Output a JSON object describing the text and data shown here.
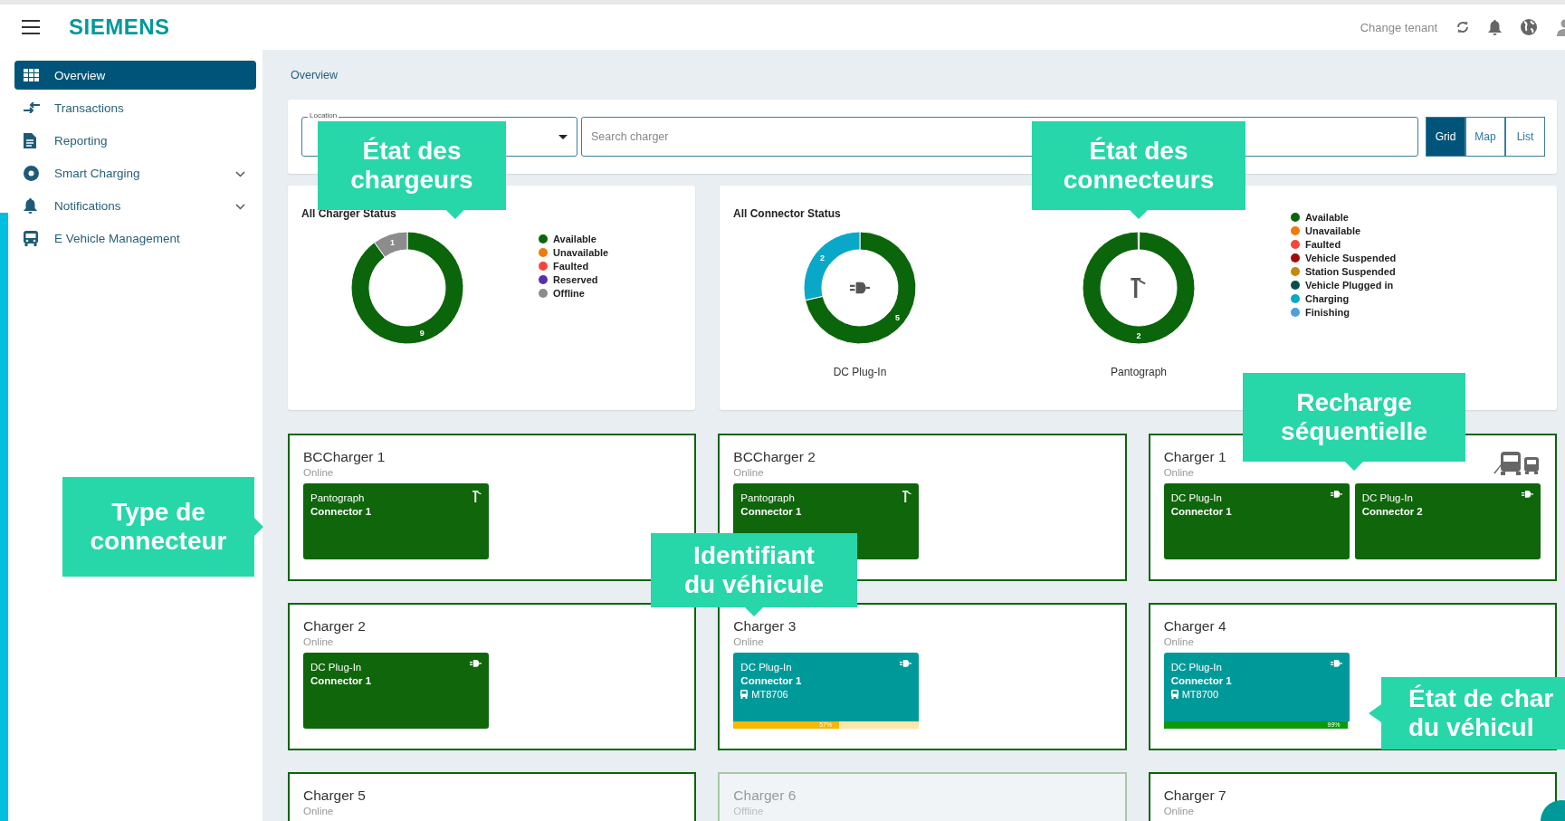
{
  "header": {
    "logo": "SIEMENS",
    "tenant_label": "Change tenant"
  },
  "sidebar": {
    "items": [
      {
        "label": "Overview",
        "selected": true,
        "expandable": false
      },
      {
        "label": "Transactions",
        "selected": false,
        "expandable": false
      },
      {
        "label": "Reporting",
        "selected": false,
        "expandable": false
      },
      {
        "label": "Smart Charging",
        "selected": false,
        "expandable": true
      },
      {
        "label": "Notifications",
        "selected": false,
        "expandable": true
      },
      {
        "label": "E Vehicle Management",
        "selected": false,
        "expandable": false
      }
    ]
  },
  "breadcrumb": "Overview",
  "filters": {
    "location": {
      "label": "Location"
    },
    "search": {
      "placeholder": "Search charger"
    },
    "views": [
      {
        "label": "Grid",
        "selected": true
      },
      {
        "label": "Map",
        "selected": false
      },
      {
        "label": "List",
        "selected": false
      }
    ]
  },
  "charger_status": {
    "title": "All Charger Status",
    "chart_data": {
      "type": "donut",
      "categories": [
        "Available",
        "Unavailable",
        "Faulted",
        "Reserved",
        "Offline"
      ],
      "values": [
        9,
        0,
        0,
        0,
        1
      ],
      "colors": [
        "#0b650b",
        "#f07a0a",
        "#f4473a",
        "#5530b0",
        "#8c8c8c"
      ],
      "legend": "right",
      "data_labels": true
    }
  },
  "connector_status": {
    "title": "All Connector Status",
    "charts": [
      {
        "kind": "plug"
      },
      {
        "kind": "pantograph"
      }
    ],
    "chart_data": {
      "type": "donut",
      "categories": [
        "Available",
        "Unavailable",
        "Faulted",
        "Vehicle Suspended",
        "Station Suspended",
        "Vehicle Plugged in",
        "Charging",
        "Finishing"
      ],
      "legend": "right",
      "data_labels": true,
      "series": [
        {
          "name": "DC Plug-In",
          "values": [
            5,
            0,
            0,
            0,
            0,
            0,
            2,
            0
          ],
          "colors": [
            "#0b650b",
            "#f07a0a",
            "#f4473a",
            "#a30a0a",
            "#c8860f",
            "#0c4f4a",
            "#0aa8c8",
            "#4aa0e0"
          ]
        },
        {
          "name": "Pantograph",
          "values": [
            2,
            0,
            0,
            0,
            0,
            0,
            0,
            0
          ],
          "color": "#0b650b"
        }
      ]
    }
  },
  "chargers": [
    {
      "name": "BCCharger 1",
      "status": "Online",
      "online": true,
      "sequential": false,
      "connectors": [
        {
          "type": "Pantograph",
          "kind": "pantograph",
          "name": "Connector 1",
          "charging": false
        }
      ]
    },
    {
      "name": "BCCharger 2",
      "status": "Online",
      "online": true,
      "sequential": false,
      "connectors": [
        {
          "type": "Pantograph",
          "kind": "pantograph",
          "name": "Connector 1",
          "charging": false
        }
      ]
    },
    {
      "name": "Charger 1",
      "status": "Online",
      "online": true,
      "sequential": true,
      "connectors": [
        {
          "type": "DC Plug-In",
          "kind": "plug",
          "name": "Connector 1",
          "charging": false
        },
        {
          "type": "DC Plug-In",
          "kind": "plug",
          "name": "Connector 2",
          "charging": false
        }
      ]
    },
    {
      "name": "Charger 2",
      "status": "Online",
      "online": true,
      "sequential": false,
      "connectors": [
        {
          "type": "DC Plug-In",
          "kind": "plug",
          "name": "Connector 1",
          "charging": false
        }
      ]
    },
    {
      "name": "Charger 3",
      "status": "Online",
      "online": true,
      "sequential": false,
      "connectors": [
        {
          "type": "DC Plug-In",
          "kind": "plug",
          "name": "Connector 1",
          "charging": true,
          "vehicle": "MT8706",
          "level": 0.57,
          "reading": "57%"
        }
      ]
    },
    {
      "name": "Charger 4",
      "status": "Online",
      "online": true,
      "sequential": false,
      "connectors": [
        {
          "type": "DC Plug-In",
          "kind": "plug",
          "name": "Connector 1",
          "charging": true,
          "vehicle": "MT8700",
          "level": 0.99,
          "reading": "99%"
        }
      ]
    },
    {
      "name": "Charger 5",
      "status": "Online",
      "online": true,
      "sequential": false
    },
    {
      "name": "Charger 6",
      "status": "Offline",
      "online": false,
      "sequential": false
    },
    {
      "name": "Charger 7",
      "status": "Online",
      "online": true,
      "sequential": false
    }
  ],
  "callouts": [
    {
      "lines": [
        "État des",
        "chargeurs"
      ],
      "kind": "down"
    },
    {
      "lines": [
        "État des",
        "connecteurs"
      ],
      "kind": "down"
    },
    {
      "lines": [
        "Recharge",
        "séquentielle"
      ],
      "kind": "down"
    },
    {
      "lines": [
        "Type de",
        "connecteur"
      ],
      "kind": "right"
    },
    {
      "lines": [
        "Identifiant",
        "du véhicule"
      ],
      "kind": "down"
    },
    {
      "lines": [
        "État de char",
        "du véhicul"
      ],
      "kind": "left"
    }
  ]
}
